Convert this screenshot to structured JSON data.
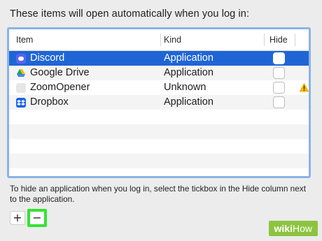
{
  "heading": "These items will open automatically when you log in:",
  "table": {
    "columns": {
      "item": "Item",
      "kind": "Kind",
      "hide": "Hide"
    },
    "rows": [
      {
        "name": "Discord",
        "kind": "Application",
        "hide": false,
        "selected": true,
        "icon": "discord-icon",
        "warning": false
      },
      {
        "name": "Google Drive",
        "kind": "Application",
        "hide": false,
        "selected": false,
        "icon": "google-drive-icon",
        "warning": false
      },
      {
        "name": "ZoomOpener",
        "kind": "Unknown",
        "hide": false,
        "selected": false,
        "icon": "blank-app-icon",
        "warning": true
      },
      {
        "name": "Dropbox",
        "kind": "Application",
        "hide": false,
        "selected": false,
        "icon": "dropbox-icon",
        "warning": false
      }
    ]
  },
  "footer_text": "To hide an application when you log in, select the tickbox in the Hide column next to the application.",
  "buttons": {
    "add": "+",
    "remove": "−"
  },
  "colors": {
    "selection": "#1f65d6",
    "highlight": "#34e334",
    "warning": "#f2b705",
    "badge": "#8cc43f"
  },
  "watermark": {
    "brand": "wiki",
    "suffix": "How"
  }
}
